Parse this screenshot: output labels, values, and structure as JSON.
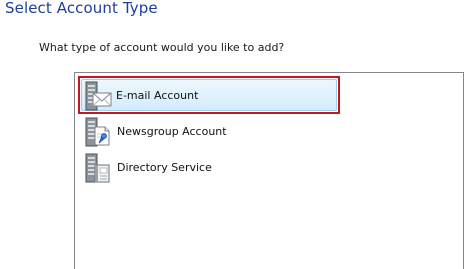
{
  "header": {
    "title": "Select Account Type",
    "prompt": "What type of account would you like to add?"
  },
  "account_types": {
    "items": [
      {
        "label": "E-mail Account",
        "icon": "email-server-icon",
        "selected": true
      },
      {
        "label": "Newsgroup Account",
        "icon": "newsgroup-server-icon",
        "selected": false
      },
      {
        "label": "Directory Service",
        "icon": "directory-server-icon",
        "selected": false
      }
    ]
  },
  "colors": {
    "title": "#1e3f98",
    "selection_outline": "#c4161c",
    "selection_fill": "#d4ecfb",
    "list_border": "#828790"
  }
}
